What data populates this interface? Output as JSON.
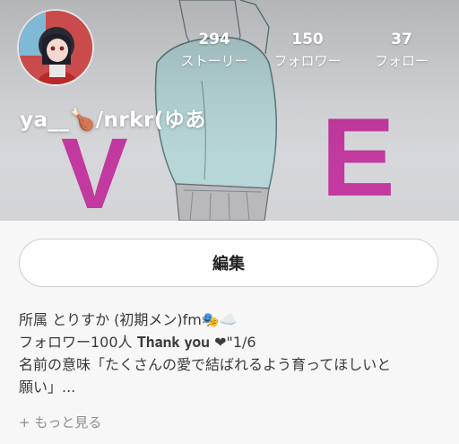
{
  "profile": {
    "name": "ya__🍗/nrkr(ゆあ",
    "avatar_alt": "avatar"
  },
  "stats": [
    {
      "value": "294",
      "label": "ストーリー"
    },
    {
      "value": "150",
      "label": "フォロワー"
    },
    {
      "value": "37",
      "label": "フォロー"
    }
  ],
  "cover": {
    "letters": [
      "V",
      "E"
    ],
    "letter_color": "#c2399f"
  },
  "edit_button": {
    "label": "編集"
  },
  "bio": {
    "lines": [
      "所属 とりすか (初期メン)fm🎭☁️",
      "フォロワー100人 𝐓𝐡𝐚𝐧𝐤 𝐲𝐨𝐮 ❤\"1/6",
      "名前の意味「たくさんの愛で結ばれるよう育ってほしいと",
      "願い」..."
    ]
  },
  "see_more": {
    "label": "+ もっと見る"
  }
}
